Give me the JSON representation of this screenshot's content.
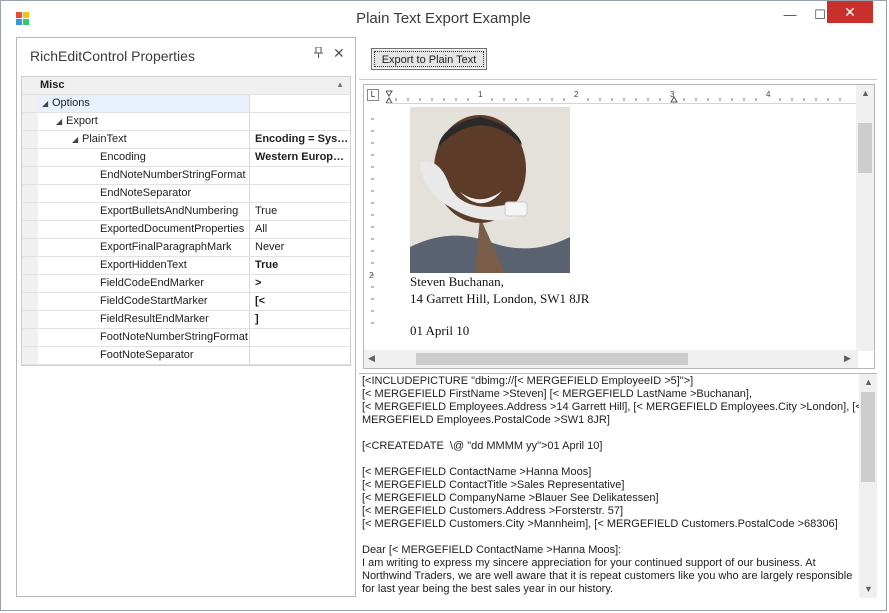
{
  "window": {
    "title": "Plain Text Export Example",
    "controls": {
      "minimize": "—",
      "maximize": "☐",
      "close": "✕"
    }
  },
  "properties_panel": {
    "title": "RichEditControl Properties",
    "pin_glyph": "📌",
    "close_glyph": "✕",
    "rows": [
      {
        "name": "Misc",
        "value": "",
        "type": "category"
      },
      {
        "name": "Options",
        "value": "",
        "type": "expanded",
        "level": 1
      },
      {
        "name": "Export",
        "value": "",
        "type": "expanded",
        "level": 2
      },
      {
        "name": "PlainText",
        "value": "Encoding = Sys…",
        "type": "expanded",
        "level": 3,
        "bold": true
      },
      {
        "name": "Encoding",
        "value": "Western Europ…",
        "level": 4,
        "bold": true
      },
      {
        "name": "EndNoteNumberStringFormat",
        "value": "",
        "level": 4
      },
      {
        "name": "EndNoteSeparator",
        "value": "",
        "level": 4
      },
      {
        "name": "ExportBulletsAndNumbering",
        "value": "True",
        "level": 4
      },
      {
        "name": "ExportedDocumentProperties",
        "value": "All",
        "level": 4
      },
      {
        "name": "ExportFinalParagraphMark",
        "value": "Never",
        "level": 4
      },
      {
        "name": "ExportHiddenText",
        "value": "True",
        "level": 4,
        "bold": true
      },
      {
        "name": "FieldCodeEndMarker",
        "value": ">",
        "level": 4,
        "bold": true
      },
      {
        "name": "FieldCodeStartMarker",
        "value": "[<",
        "level": 4,
        "bold": true
      },
      {
        "name": "FieldResultEndMarker",
        "value": "]",
        "level": 4,
        "bold": true
      },
      {
        "name": "FootNoteNumberStringFormat",
        "value": "",
        "level": 4
      },
      {
        "name": "FootNoteSeparator",
        "value": "",
        "level": 4
      }
    ]
  },
  "toolbar": {
    "export_label": "Export to Plain Text"
  },
  "editor": {
    "ruler_numbers": [
      "1",
      "2",
      "3",
      "4"
    ],
    "vertical_ruler_number": "2",
    "doc_lines": [
      "Steven Buchanan,",
      "14 Garrett Hill, London, SW1 8JR",
      "01 April 10"
    ]
  },
  "plain_text_output": {
    "lines": [
      "[<INCLUDEPICTURE \"dbimg://[< MERGEFIELD EmployeeID >5]\">]",
      "[< MERGEFIELD FirstName >Steven] [< MERGEFIELD LastName >Buchanan],",
      "[< MERGEFIELD Employees.Address >14 Garrett Hill], [< MERGEFIELD Employees.City >London], [<",
      "MERGEFIELD Employees.PostalCode >SW1 8JR]",
      "",
      "[<CREATEDATE  \\@ \"dd MMMM yy\">01 April 10]",
      "",
      "[< MERGEFIELD ContactName >Hanna Moos]",
      "[< MERGEFIELD ContactTitle >Sales Representative]",
      "[< MERGEFIELD CompanyName >Blauer See Delikatessen]",
      "[< MERGEFIELD Customers.Address >Forsterstr. 57]",
      "[< MERGEFIELD Customers.City >Mannheim], [< MERGEFIELD Customers.PostalCode >68306]",
      "",
      "Dear [< MERGEFIELD ContactName >Hanna Moos]:",
      "I am writing to express my sincere appreciation for your continued support of our business. At",
      "Northwind Traders, we are well aware that it is repeat customers like you who are largely responsible",
      "for last year being the best sales year in our history."
    ]
  }
}
